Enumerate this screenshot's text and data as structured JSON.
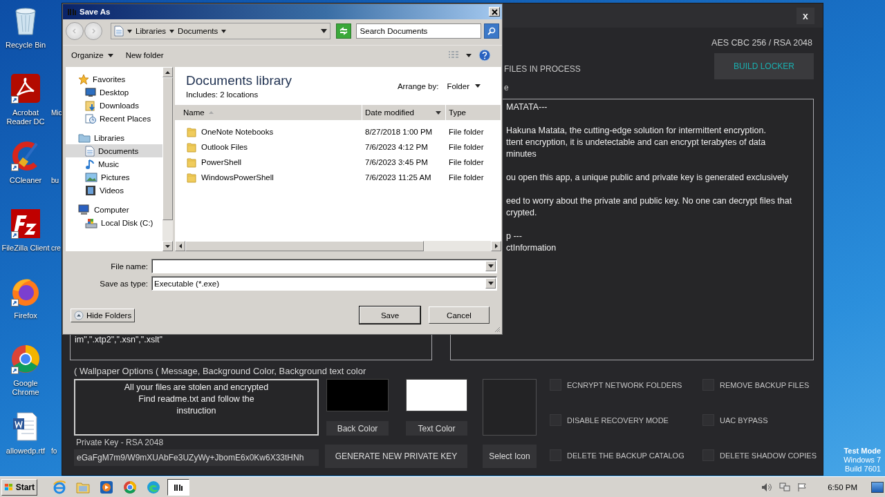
{
  "desktop": {
    "icons": [
      {
        "kind": "recycle-bin",
        "label": "Recycle Bin",
        "shortcut": false
      },
      {
        "kind": "pdf-reader",
        "label": "Acrobat Reader DC",
        "shortcut": true,
        "next_column_label": "Mic"
      },
      {
        "kind": "cleaner",
        "label": "CCleaner",
        "shortcut": true,
        "next_column_label": "bu"
      },
      {
        "kind": "ftp-client",
        "label": "FileZilla Client",
        "shortcut": true,
        "next_column_label": "cre"
      },
      {
        "kind": "fox-browser",
        "label": "Firefox",
        "shortcut": true
      },
      {
        "kind": "chrome-browser",
        "label": "Google Chrome",
        "shortcut": true
      },
      {
        "kind": "word-document",
        "label": "allowedp.rtf",
        "shortcut": false,
        "next_column_label": "fo"
      }
    ],
    "os_notice": [
      "Test Mode",
      "Windows 7",
      "Build 7601"
    ]
  },
  "builder_window": {
    "close": "x",
    "cipher_label": "AES CBC 256 / RSA 2048",
    "build_button": "BUILD LOCKER",
    "files_label": "FILES IN PROCESS",
    "note_label": "e",
    "note_paragraphs": [
      [
        "MATATA---"
      ],
      [
        "Hakuna Matata, the cutting-edge solution for intermittent encryption.",
        "ttent encryption, it is undetectable and can encrypt terabytes of data",
        "minutes"
      ],
      [
        "ou open this app, a unique public and private key is generated exclusively"
      ],
      [
        "eed to worry about the private and public key. No one can decrypt files that",
        "crypted."
      ],
      [
        "p ---",
        "ctInformation"
      ]
    ],
    "extensions_text": "im\",\".xtp2\",\".xsn\",\".xslt\"",
    "wallpaper_label": "( Wallpaper Options ( Message, Background Color, Background text color",
    "wallpaper_message": [
      "All your files are stolen and encrypted",
      "Find readme.txt and follow the",
      "instruction"
    ],
    "swatches": [
      {
        "button": "Back Color",
        "color": "#000000"
      },
      {
        "button": "Text Color",
        "color": "#ffffff"
      }
    ],
    "icon_button": "Select Icon",
    "options": [
      {
        "label": "ECNRYPT NETWORK FOLDERS",
        "checked": false
      },
      {
        "label": "REMOVE BACKUP FILES",
        "checked": false
      },
      {
        "label": "DISABLE RECOVERY MODE",
        "checked": false
      },
      {
        "label": "UAC BYPASS",
        "checked": false
      },
      {
        "label": "DELETE THE BACKUP CATALOG",
        "checked": false
      },
      {
        "label": "DELETE SHADOW COPIES",
        "checked": false
      }
    ],
    "private_key_label": "Private Key - RSA 2048",
    "private_key_value": "eGaFgM7m9/W9mXUAbFe3UZyWy+JbomE6x0Kw6X33tHNh",
    "generate_button": "GENERATE NEW PRIVATE KEY"
  },
  "save_dialog": {
    "title": "Save As",
    "breadcrumb": [
      "Libraries",
      "Documents"
    ],
    "search_placeholder": "Search Documents",
    "organize": "Organize",
    "new_folder": "New folder",
    "nav_tree": [
      {
        "kind": "star",
        "label": "Favorites",
        "selected": false,
        "children": [
          {
            "kind": "desktop",
            "label": "Desktop",
            "selected": false
          },
          {
            "kind": "downloads",
            "label": "Downloads",
            "selected": false
          },
          {
            "kind": "recent",
            "label": "Recent Places",
            "selected": false
          }
        ]
      },
      {
        "kind": "library",
        "label": "Libraries",
        "selected": false,
        "children": [
          {
            "kind": "document",
            "label": "Documents",
            "selected": true
          },
          {
            "kind": "music",
            "label": "Music",
            "selected": false
          },
          {
            "kind": "pictures",
            "label": "Pictures",
            "selected": false
          },
          {
            "kind": "videos",
            "label": "Videos",
            "selected": false
          }
        ]
      },
      {
        "kind": "computer",
        "label": "Computer",
        "selected": false,
        "children": [
          {
            "kind": "disk",
            "label": "Local Disk (C:)",
            "selected": false
          }
        ]
      }
    ],
    "library_title": "Documents library",
    "library_includes": "Includes:  2 locations",
    "arrange_label": "Arrange by:",
    "arrange_value": "Folder",
    "columns": [
      "Name",
      "Date modified",
      "Type"
    ],
    "rows": [
      {
        "name": "OneNote Notebooks",
        "date": "8/27/2018 1:00 PM",
        "type": "File folder"
      },
      {
        "name": "Outlook Files",
        "date": "7/6/2023 4:12 PM",
        "type": "File folder"
      },
      {
        "name": "PowerShell",
        "date": "7/6/2023 3:45 PM",
        "type": "File folder"
      },
      {
        "name": "WindowsPowerShell",
        "date": "7/6/2023 11:25 AM",
        "type": "File folder"
      }
    ],
    "file_name_label": "File name:",
    "type_label": "Save as type:",
    "type_value": "Executable (*.exe)",
    "hide_folders": "Hide Folders",
    "save": "Save",
    "cancel": "Cancel"
  },
  "taskbar": {
    "start": "Start",
    "apps": [
      {
        "kind": "ie",
        "selected": false
      },
      {
        "kind": "explorer",
        "selected": false
      },
      {
        "kind": "media",
        "selected": false
      },
      {
        "kind": "chrome",
        "selected": false
      },
      {
        "kind": "edge",
        "selected": false
      },
      {
        "kind": "builder",
        "selected": true
      }
    ],
    "clock": "6:50 PM"
  }
}
